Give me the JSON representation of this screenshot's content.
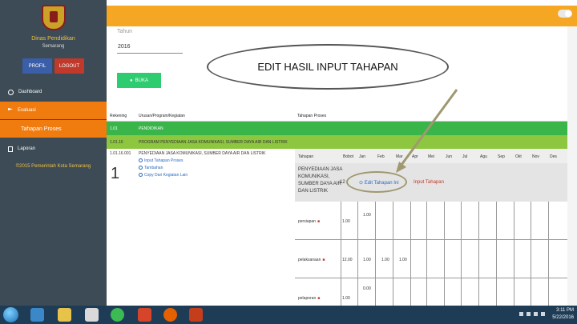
{
  "sidebar": {
    "org_name": "Dinas Pendidikan",
    "org_city": "Semarang",
    "profil_label": "PROFIL",
    "logout_label": "LOGOUT",
    "menu": [
      {
        "label": "Dashboard",
        "icon": "dashboard-icon"
      },
      {
        "label": "Evaluasi",
        "icon": "flag-icon"
      },
      {
        "label": "Tahapan Proses",
        "icon": ""
      },
      {
        "label": "Laporan",
        "icon": "document-icon"
      }
    ],
    "copyright": "©2015 Pemerintah Kota Semarang"
  },
  "form": {
    "tahun_label": "Tahun",
    "tahun_value": "2016",
    "buka_label": "BUKA"
  },
  "annotation": {
    "text": "EDIT HASIL INPUT TAHAPAN"
  },
  "table": {
    "headers": [
      "Rekening",
      "Urusan/Program/Kegiatan",
      "Tahapan Proses"
    ],
    "row1": {
      "rekening": "1.01",
      "name": "PENDIDIKAN"
    },
    "row2": {
      "rekening": "1.01.16",
      "name": "PROGRAM PENYEDIAAN JASA KOMUNIKASI, SUMBER DAYA AIR DAN LISTRIK"
    },
    "main_row": {
      "rekening": "1.01.16.001",
      "name": "PENYEDIAAN JASA KOMUNIKASI, SUMBER DAYA AIR DAN LISTRIK",
      "number": "1",
      "links": [
        "Input Tahapan Proses",
        "Tambahan",
        "Copy Dari Kegiatan Lain"
      ]
    },
    "inner_headers": [
      "Tahapan",
      "Bobot",
      "Jan",
      "Feb",
      "Mar",
      "Apr",
      "Mei",
      "Jun",
      "Jul",
      "Agu",
      "Sep",
      "Okt",
      "Nov",
      "Des"
    ],
    "proses": {
      "name": "PENYEDIAAN JASA KOMUNIKASI, SUMBER DAYA AIR DAN LISTRIK",
      "number": "12",
      "edit_label": "Edit Tahapan Ini",
      "input_label": "Input Tahapan"
    },
    "sub_rows": [
      {
        "name": "persiapan",
        "bobot": "1.00",
        "values": [
          "1.00"
        ]
      },
      {
        "name": "pelaksanaan",
        "bobot": "12.00",
        "values": [
          "1.00",
          "1.00",
          "1.00"
        ]
      },
      {
        "name": "pelaporan",
        "bobot": "1.00",
        "values": [
          "0.00"
        ]
      }
    ]
  },
  "taskbar": {
    "time": "3:11 PM",
    "date": "5/22/2016"
  },
  "colors": {
    "sidebar": "#3c4b56",
    "accent_orange": "#f07c10",
    "topbar": "#f5a623",
    "green_dark": "#39b54a",
    "green_light": "#8dc63f",
    "button_green": "#2ecc71"
  }
}
